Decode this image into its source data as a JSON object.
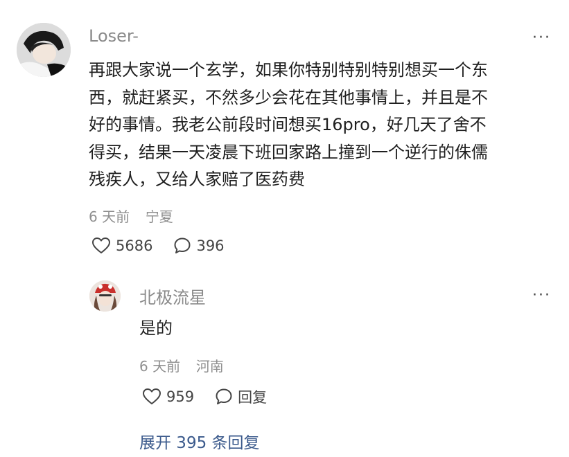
{
  "comment": {
    "username": "Loser-",
    "text_lines": [
      "再跟大家说一个玄学，如果你特别特别特别想买一个东",
      "西，就赶紧买，不然多少会花在其他事情上，并且是不",
      "好的事情。我老公前段时间想买16pro，好几天了舍不",
      "得买，结果一天凌晨下班回家路上撞到一个逆行的侏儒",
      "残疾人，又给人家赔了医药费"
    ],
    "time": "6 天前",
    "location": "宁夏",
    "likes": "5686",
    "comments": "396",
    "more": "···"
  },
  "reply": {
    "username": "北极流星",
    "text": "是的",
    "time": "6 天前",
    "location": "河南",
    "likes": "959",
    "reply_label": "回复",
    "more": "···"
  },
  "expand_label": "展开 395 条回复",
  "icons": {
    "like": "heart-icon",
    "comment": "speech-bubble-icon",
    "more": "more-dots-icon"
  }
}
